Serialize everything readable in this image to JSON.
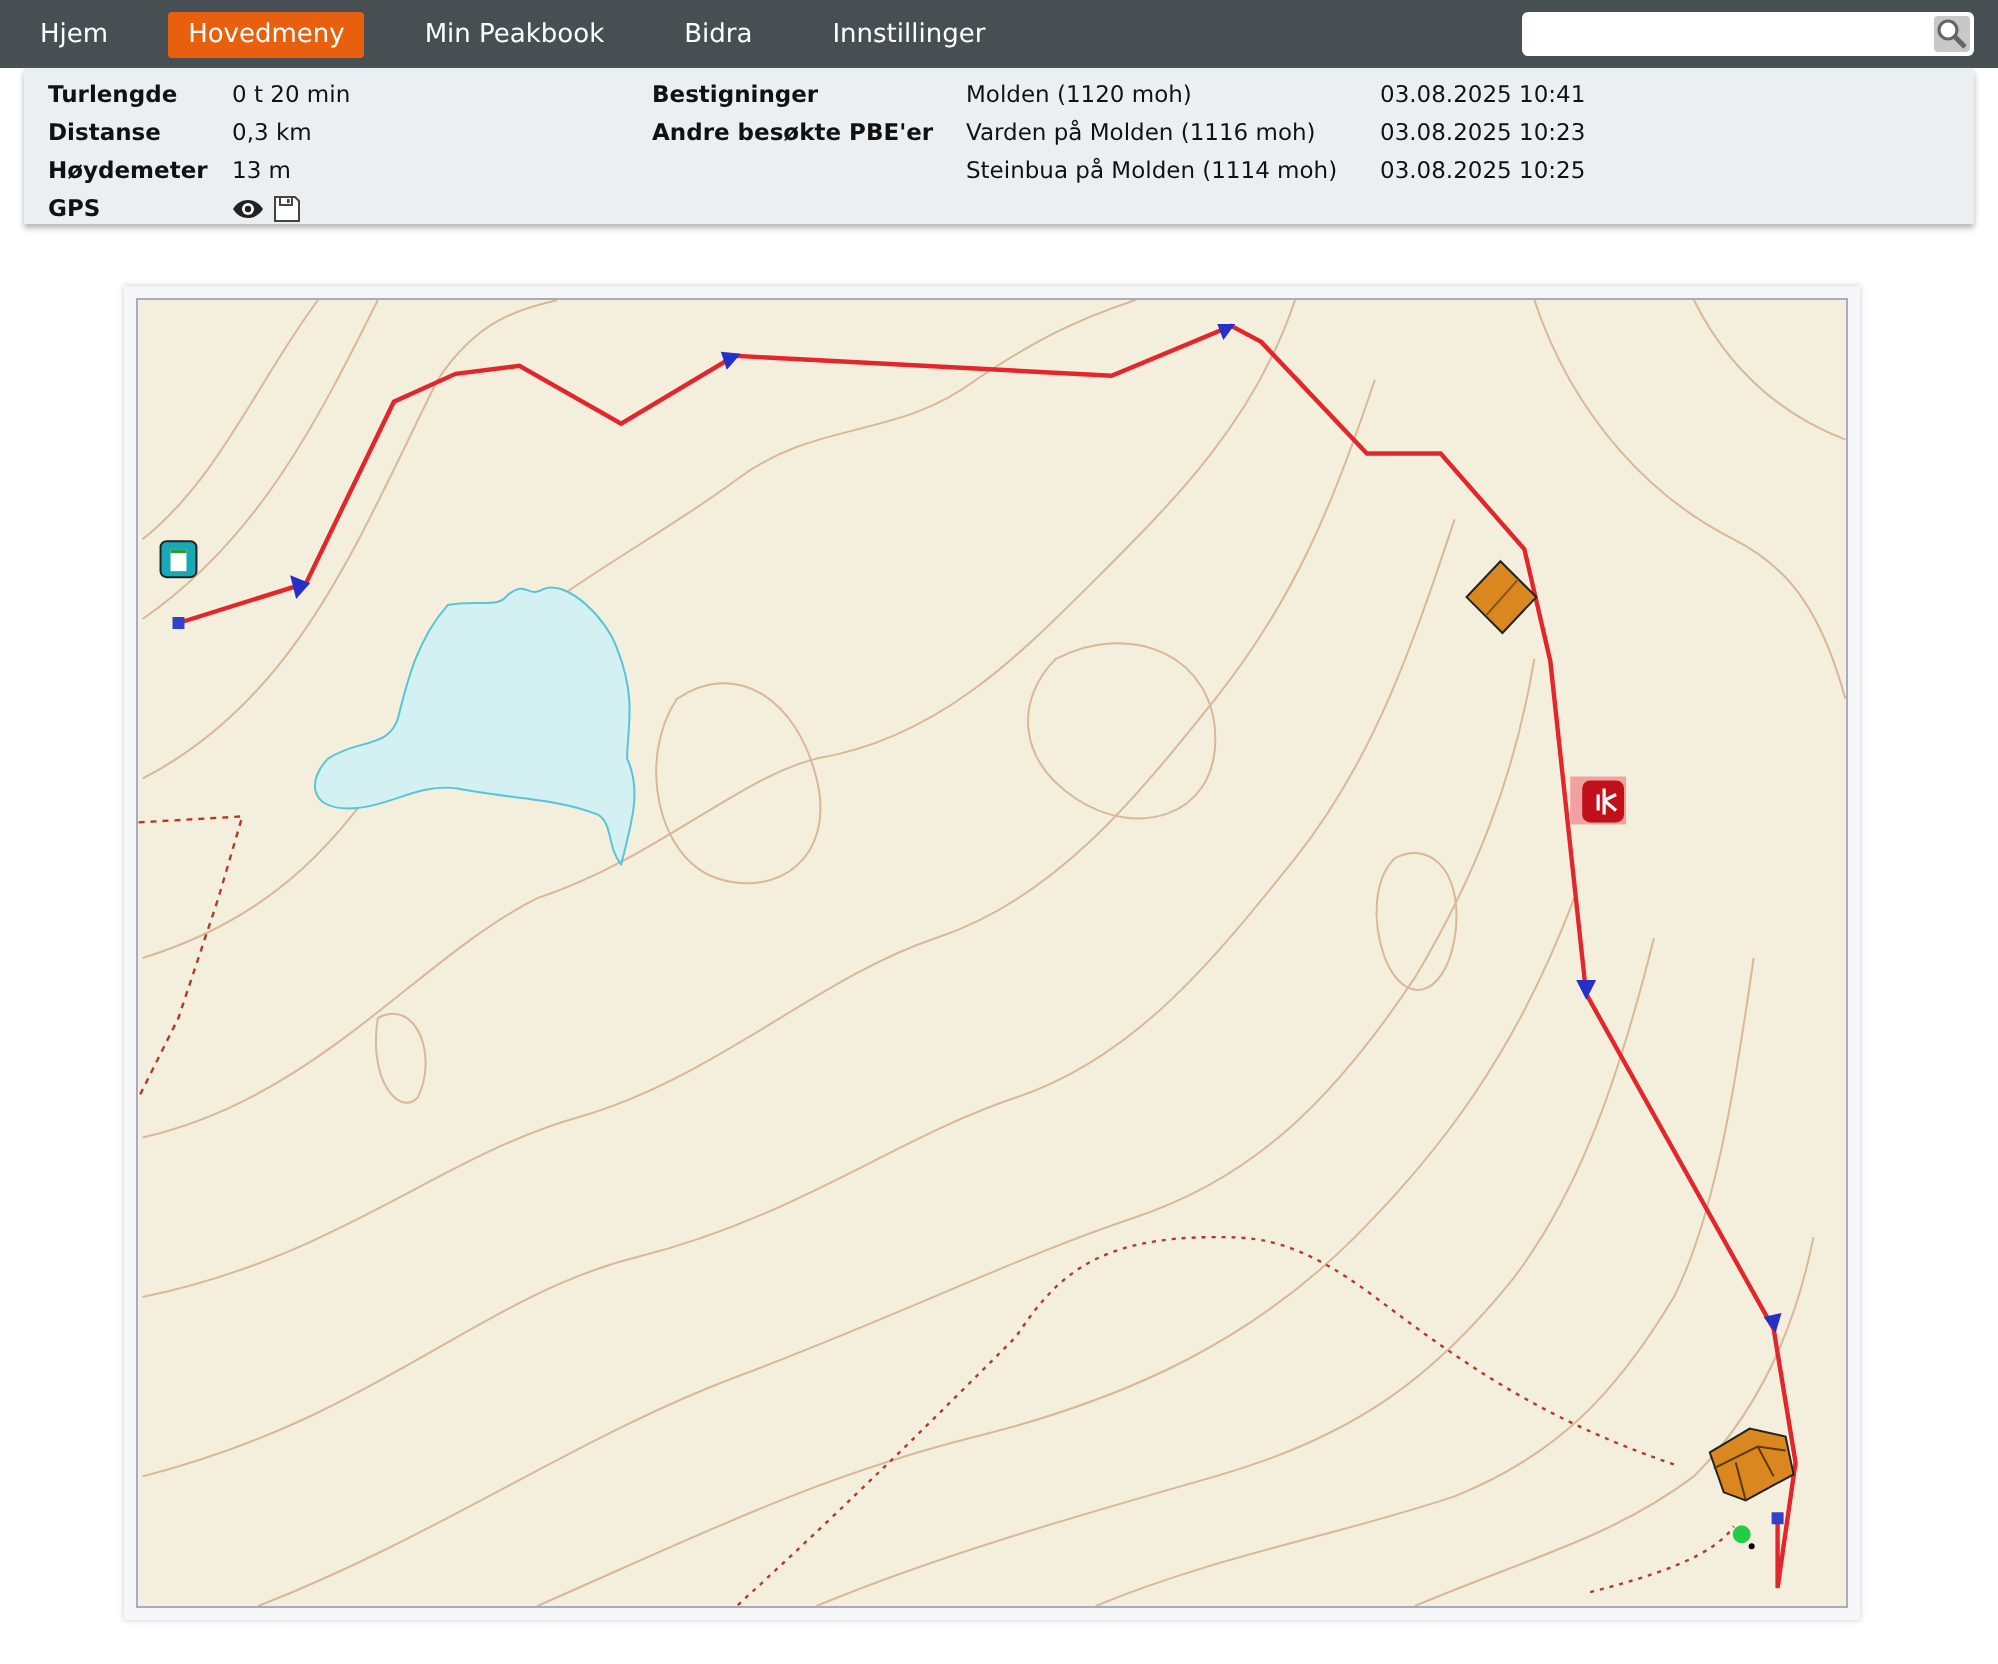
{
  "nav": [
    {
      "label": "Hjem",
      "selected": false
    },
    {
      "label": "Hovedmeny",
      "selected": true
    },
    {
      "label": "Min Peakbook",
      "selected": false
    },
    {
      "label": "Bidra",
      "selected": false
    },
    {
      "label": "Innstillinger",
      "selected": false
    }
  ],
  "stats": [
    {
      "label": "Turlengde",
      "value": "0 t 20 min"
    },
    {
      "label": "Distanse",
      "value": "0,3 km"
    },
    {
      "label": "Høydemeter",
      "value": "13 m"
    }
  ],
  "gps": {
    "label": "GPS"
  },
  "visits": [
    {
      "label": "Bestigninger",
      "entries": [
        {
          "place": "Molden (1120 moh)",
          "time": "03.08.2025 10:41"
        }
      ]
    },
    {
      "label": "Andre besøkte PBE'er",
      "entries": [
        {
          "place": "Varden på Molden (1116 moh)",
          "time": "03.08.2025 10:23"
        },
        {
          "place": "Steinbua på Molden (1114 moh)",
          "time": "03.08.2025 10:25"
        }
      ]
    }
  ]
}
